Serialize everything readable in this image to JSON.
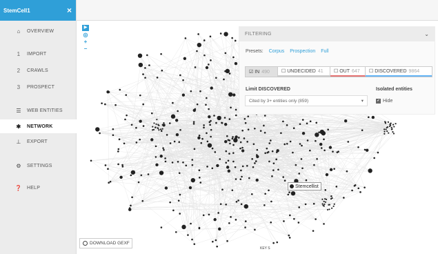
{
  "sidebar": {
    "corpus_name": "StemCell1",
    "close_icon": "×",
    "items": [
      {
        "lead": "⌂",
        "label": "OVERVIEW",
        "icon": "home-icon"
      },
      {
        "lead": "1",
        "label": "IMPORT"
      },
      {
        "lead": "2",
        "label": "CRAWLS"
      },
      {
        "lead": "3",
        "label": "PROSPECT"
      },
      {
        "lead": "☰",
        "label": "WEB ENTITIES",
        "icon": "list-icon"
      },
      {
        "lead": "✱",
        "label": "NETWORK",
        "icon": "network-icon",
        "active": true
      },
      {
        "lead": "⊥",
        "label": "EXPORT",
        "icon": "export-icon"
      },
      {
        "lead": "⚙",
        "label": "SETTINGS",
        "icon": "gear-icon"
      },
      {
        "lead": "❓",
        "label": "HELP",
        "icon": "help-icon"
      }
    ]
  },
  "zoom": {
    "play": "▶",
    "center": "◎",
    "zoom_in": "+",
    "zoom_out": "−"
  },
  "filter": {
    "title": "FILTERING",
    "chevron": "⌄",
    "presets_label": "Presets:",
    "presets": [
      "Corpus",
      "Prospection",
      "Full"
    ],
    "tabs": [
      {
        "label": "IN",
        "count": "490",
        "checked": true
      },
      {
        "label": "UNDECIDED",
        "count": "41",
        "checked": false
      },
      {
        "label": "OUT",
        "count": "647",
        "checked": false
      },
      {
        "label": "DISCOVERED",
        "count": "9864",
        "checked": false
      }
    ],
    "limit_label": "Limit DISCOVERED",
    "limit_value": "Cited by 3+ entities only (859)",
    "isolated_label": "Isolated entities",
    "hide_label": "Hide"
  },
  "node_label": "Stemcellist",
  "download_label": "DOWNLOAD GEXF",
  "key_label": "KEY S",
  "colors": {
    "accent": "#2f9fd8",
    "out": "#e57373",
    "discovered": "#64b5f6",
    "node": "#222222",
    "edge": "#e3e3e3"
  }
}
